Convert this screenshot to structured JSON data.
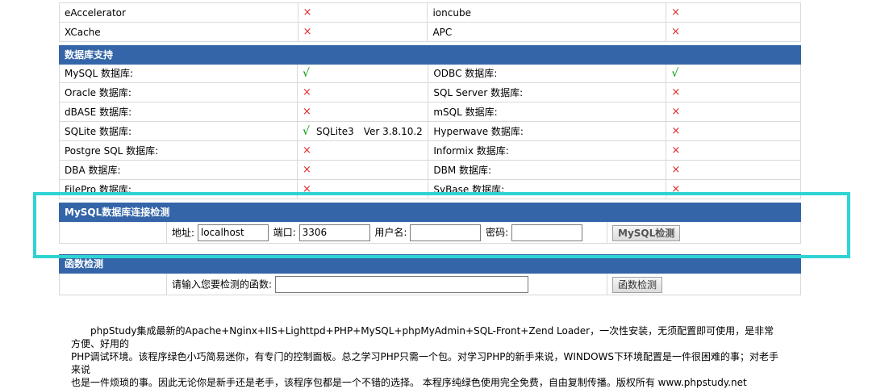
{
  "accelerators": [
    {
      "name": "eAccelerator",
      "status": "×",
      "name2": "ioncube",
      "status2": "×"
    },
    {
      "name": "XCache",
      "status": "×",
      "name2": "APC",
      "status2": "×"
    }
  ],
  "database": {
    "title": "数据库支持",
    "rows": [
      {
        "name": "MySQL 数据库:",
        "status": "√",
        "extra": "",
        "name2": "ODBC 数据库:",
        "status2": "√"
      },
      {
        "name": "Oracle 数据库:",
        "status": "×",
        "extra": "",
        "name2": "SQL Server 数据库:",
        "status2": "×"
      },
      {
        "name": "dBASE 数据库:",
        "status": "×",
        "extra": "",
        "name2": "mSQL 数据库:",
        "status2": "×"
      },
      {
        "name": "SQLite 数据库:",
        "status": "√",
        "extra": "SQLite3　Ver 3.8.10.2",
        "name2": "Hyperwave 数据库:",
        "status2": "×"
      },
      {
        "name": "Postgre SQL 数据库:",
        "status": "×",
        "extra": "",
        "name2": "Informix 数据库:",
        "status2": "×"
      },
      {
        "name": "DBA 数据库:",
        "status": "×",
        "extra": "",
        "name2": "DBM 数据库:",
        "status2": "×"
      },
      {
        "name": "FilePro 数据库:",
        "status": "×",
        "extra": "",
        "name2": "SyBase 数据库:",
        "status2": "×"
      }
    ]
  },
  "mysql_check": {
    "title": "MySQL数据库连接检测",
    "host_label": "地址:",
    "host_value": "localhost",
    "port_label": "端口:",
    "port_value": "3306",
    "user_label": "用户名:",
    "user_value": "",
    "pass_label": "密码:",
    "pass_value": "",
    "button": "MySQL检测"
  },
  "function_check": {
    "title": "函数检测",
    "label": "请输入您要检测的函数:",
    "value": "",
    "button": "函数检测"
  },
  "footer": {
    "line1": "phpStudy集成最新的Apache+Nginx+IIS+Lighttpd+PHP+MySQL+phpMyAdmin+SQL-Front+Zend Loader，一次性安装，无须配置即可使用，是非常方便、好用的",
    "line2": "PHP调试环境。该程序绿色小巧简易迷你，有专门的控制面板。总之学习PHP只需一个包。对学习PHP的新手来说，WINDOWS下环境配置是一件很困难的事；对老手来说",
    "line3": "也是一件烦琐的事。因此无论你是新手还是老手，该程序包都是一个不错的选择。 本程序纯绿色使用完全免费，自由复制传播。版权所有 www.phpstudy.net"
  },
  "colors": {
    "header_bg": "#3365a8",
    "cross": "#e0282b",
    "check": "#009900",
    "highlight": "#2fd3d3"
  }
}
